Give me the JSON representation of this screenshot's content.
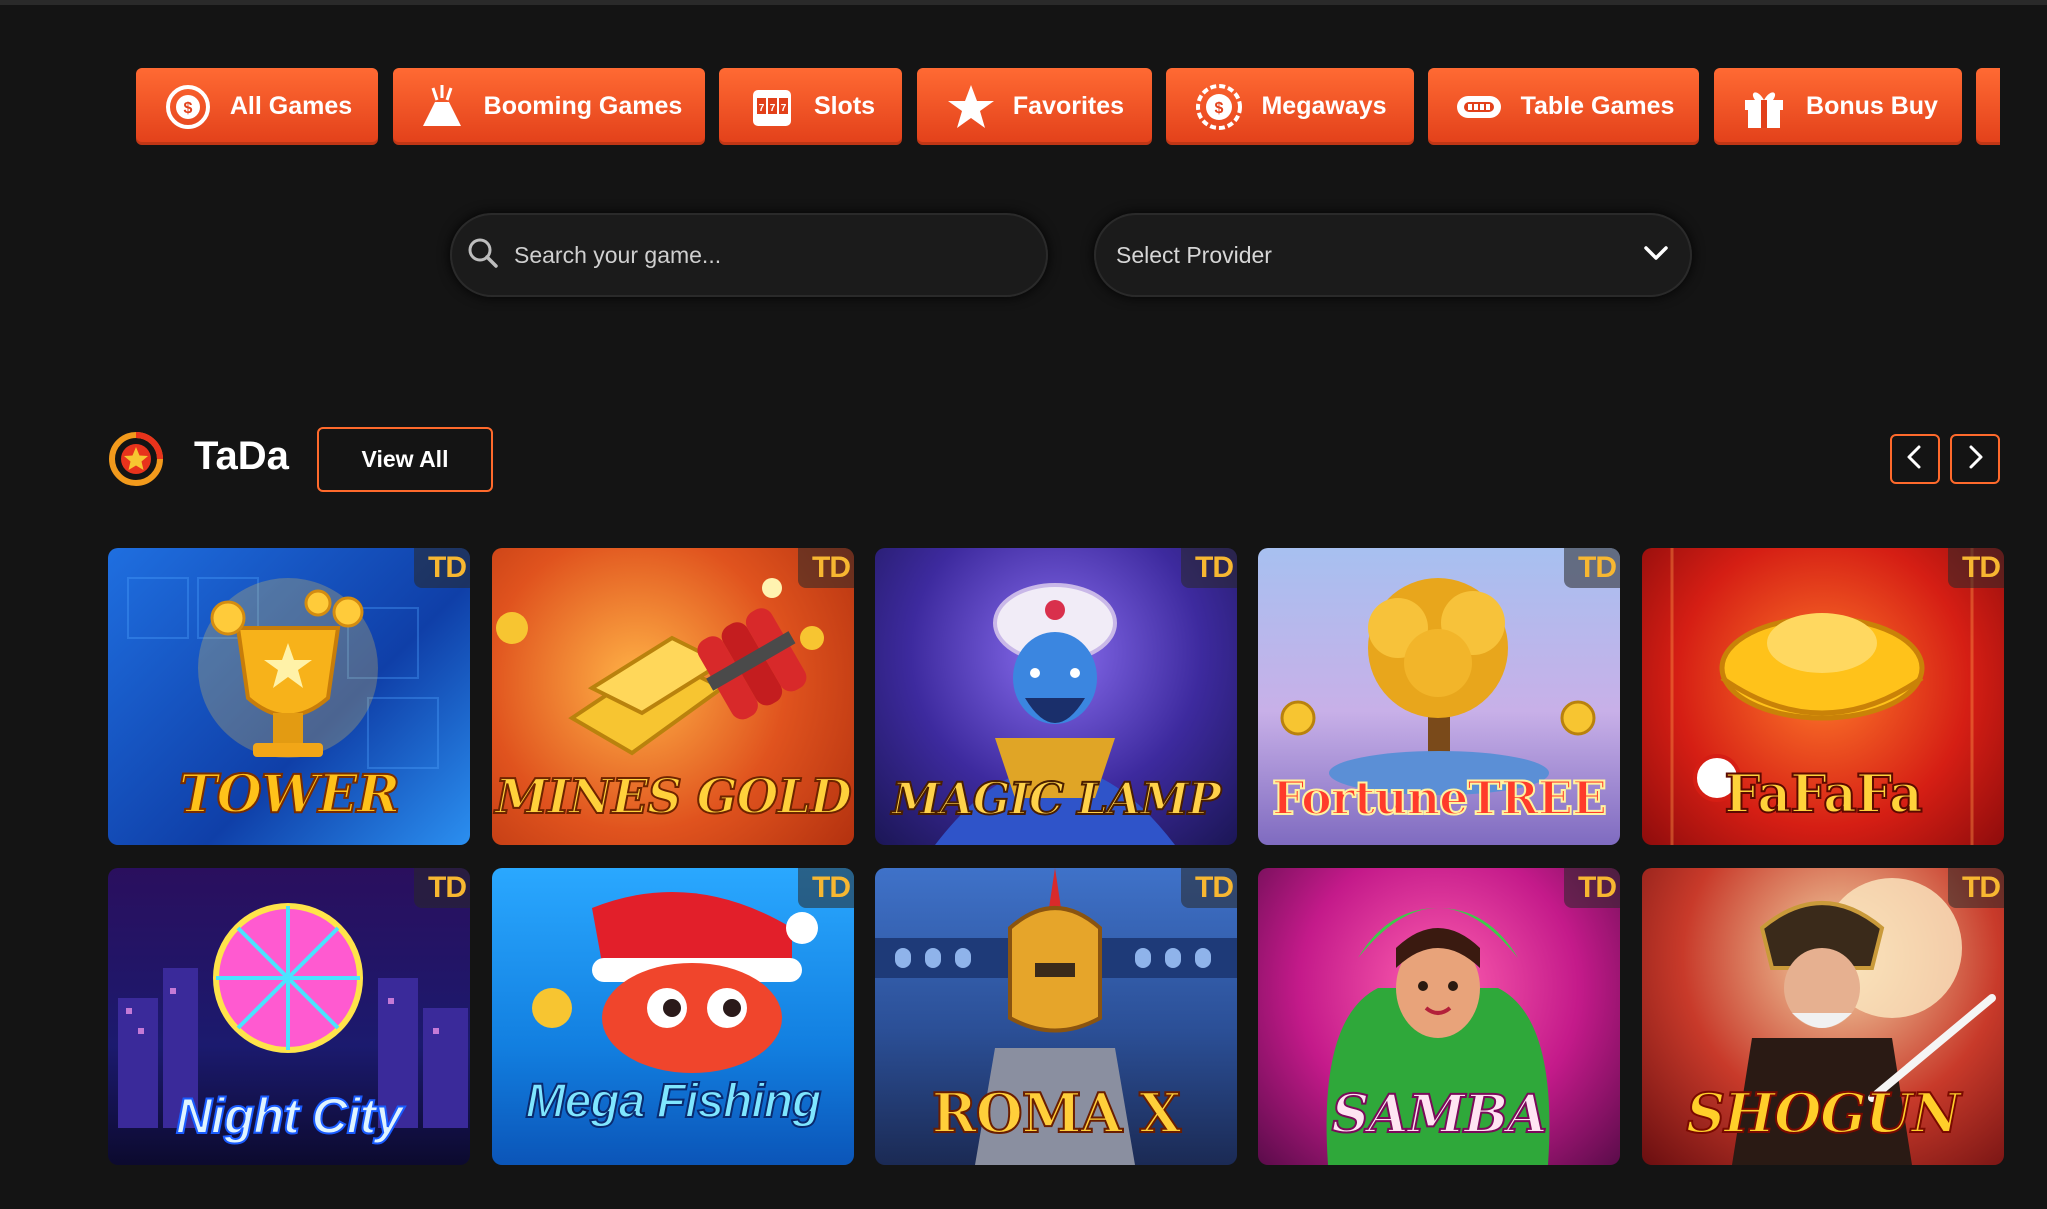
{
  "categories": [
    {
      "label": "All Games",
      "icon": "dollar-coin-icon"
    },
    {
      "label": "Booming Games",
      "icon": "volcano-icon"
    },
    {
      "label": "Slots",
      "icon": "slot-machine-icon"
    },
    {
      "label": "Favorites",
      "icon": "star-icon"
    },
    {
      "label": "Megaways",
      "icon": "dollar-chip-icon"
    },
    {
      "label": "Table Games",
      "icon": "table-icon"
    },
    {
      "label": "Bonus Buy",
      "icon": "gift-icon"
    }
  ],
  "search": {
    "placeholder": "Search your game..."
  },
  "provider_select": {
    "value": "Select Provider"
  },
  "section": {
    "title": "TaDa",
    "view_all_label": "View All",
    "provider_badge": "TD"
  },
  "games": [
    {
      "name": "TOWER"
    },
    {
      "name": "MINES GOLD"
    },
    {
      "name": "MAGIC LAMP"
    },
    {
      "name": "FortuneTREE"
    },
    {
      "name": "FaFaFa"
    },
    {
      "name": "Night City"
    },
    {
      "name": "Mega Fishing"
    },
    {
      "name": "ROMA X"
    },
    {
      "name": "SAMBA"
    },
    {
      "name": "SHOGUN"
    }
  ],
  "colors": {
    "accent": "#ff5a26",
    "background": "#141414",
    "badge": "#f7b731"
  }
}
